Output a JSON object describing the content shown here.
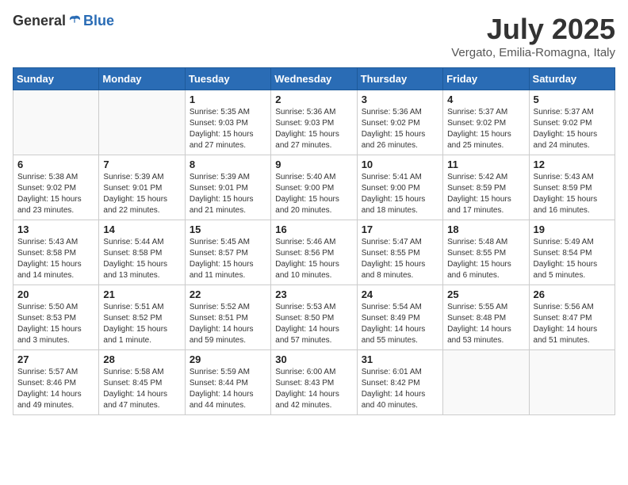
{
  "header": {
    "logo_general": "General",
    "logo_blue": "Blue",
    "month": "July 2025",
    "location": "Vergato, Emilia-Romagna, Italy"
  },
  "weekdays": [
    "Sunday",
    "Monday",
    "Tuesday",
    "Wednesday",
    "Thursday",
    "Friday",
    "Saturday"
  ],
  "weeks": [
    [
      {
        "day": "",
        "sunrise": "",
        "sunset": "",
        "daylight": ""
      },
      {
        "day": "",
        "sunrise": "",
        "sunset": "",
        "daylight": ""
      },
      {
        "day": "1",
        "sunrise": "Sunrise: 5:35 AM",
        "sunset": "Sunset: 9:03 PM",
        "daylight": "Daylight: 15 hours and 27 minutes."
      },
      {
        "day": "2",
        "sunrise": "Sunrise: 5:36 AM",
        "sunset": "Sunset: 9:03 PM",
        "daylight": "Daylight: 15 hours and 27 minutes."
      },
      {
        "day": "3",
        "sunrise": "Sunrise: 5:36 AM",
        "sunset": "Sunset: 9:02 PM",
        "daylight": "Daylight: 15 hours and 26 minutes."
      },
      {
        "day": "4",
        "sunrise": "Sunrise: 5:37 AM",
        "sunset": "Sunset: 9:02 PM",
        "daylight": "Daylight: 15 hours and 25 minutes."
      },
      {
        "day": "5",
        "sunrise": "Sunrise: 5:37 AM",
        "sunset": "Sunset: 9:02 PM",
        "daylight": "Daylight: 15 hours and 24 minutes."
      }
    ],
    [
      {
        "day": "6",
        "sunrise": "Sunrise: 5:38 AM",
        "sunset": "Sunset: 9:02 PM",
        "daylight": "Daylight: 15 hours and 23 minutes."
      },
      {
        "day": "7",
        "sunrise": "Sunrise: 5:39 AM",
        "sunset": "Sunset: 9:01 PM",
        "daylight": "Daylight: 15 hours and 22 minutes."
      },
      {
        "day": "8",
        "sunrise": "Sunrise: 5:39 AM",
        "sunset": "Sunset: 9:01 PM",
        "daylight": "Daylight: 15 hours and 21 minutes."
      },
      {
        "day": "9",
        "sunrise": "Sunrise: 5:40 AM",
        "sunset": "Sunset: 9:00 PM",
        "daylight": "Daylight: 15 hours and 20 minutes."
      },
      {
        "day": "10",
        "sunrise": "Sunrise: 5:41 AM",
        "sunset": "Sunset: 9:00 PM",
        "daylight": "Daylight: 15 hours and 18 minutes."
      },
      {
        "day": "11",
        "sunrise": "Sunrise: 5:42 AM",
        "sunset": "Sunset: 8:59 PM",
        "daylight": "Daylight: 15 hours and 17 minutes."
      },
      {
        "day": "12",
        "sunrise": "Sunrise: 5:43 AM",
        "sunset": "Sunset: 8:59 PM",
        "daylight": "Daylight: 15 hours and 16 minutes."
      }
    ],
    [
      {
        "day": "13",
        "sunrise": "Sunrise: 5:43 AM",
        "sunset": "Sunset: 8:58 PM",
        "daylight": "Daylight: 15 hours and 14 minutes."
      },
      {
        "day": "14",
        "sunrise": "Sunrise: 5:44 AM",
        "sunset": "Sunset: 8:58 PM",
        "daylight": "Daylight: 15 hours and 13 minutes."
      },
      {
        "day": "15",
        "sunrise": "Sunrise: 5:45 AM",
        "sunset": "Sunset: 8:57 PM",
        "daylight": "Daylight: 15 hours and 11 minutes."
      },
      {
        "day": "16",
        "sunrise": "Sunrise: 5:46 AM",
        "sunset": "Sunset: 8:56 PM",
        "daylight": "Daylight: 15 hours and 10 minutes."
      },
      {
        "day": "17",
        "sunrise": "Sunrise: 5:47 AM",
        "sunset": "Sunset: 8:55 PM",
        "daylight": "Daylight: 15 hours and 8 minutes."
      },
      {
        "day": "18",
        "sunrise": "Sunrise: 5:48 AM",
        "sunset": "Sunset: 8:55 PM",
        "daylight": "Daylight: 15 hours and 6 minutes."
      },
      {
        "day": "19",
        "sunrise": "Sunrise: 5:49 AM",
        "sunset": "Sunset: 8:54 PM",
        "daylight": "Daylight: 15 hours and 5 minutes."
      }
    ],
    [
      {
        "day": "20",
        "sunrise": "Sunrise: 5:50 AM",
        "sunset": "Sunset: 8:53 PM",
        "daylight": "Daylight: 15 hours and 3 minutes."
      },
      {
        "day": "21",
        "sunrise": "Sunrise: 5:51 AM",
        "sunset": "Sunset: 8:52 PM",
        "daylight": "Daylight: 15 hours and 1 minute."
      },
      {
        "day": "22",
        "sunrise": "Sunrise: 5:52 AM",
        "sunset": "Sunset: 8:51 PM",
        "daylight": "Daylight: 14 hours and 59 minutes."
      },
      {
        "day": "23",
        "sunrise": "Sunrise: 5:53 AM",
        "sunset": "Sunset: 8:50 PM",
        "daylight": "Daylight: 14 hours and 57 minutes."
      },
      {
        "day": "24",
        "sunrise": "Sunrise: 5:54 AM",
        "sunset": "Sunset: 8:49 PM",
        "daylight": "Daylight: 14 hours and 55 minutes."
      },
      {
        "day": "25",
        "sunrise": "Sunrise: 5:55 AM",
        "sunset": "Sunset: 8:48 PM",
        "daylight": "Daylight: 14 hours and 53 minutes."
      },
      {
        "day": "26",
        "sunrise": "Sunrise: 5:56 AM",
        "sunset": "Sunset: 8:47 PM",
        "daylight": "Daylight: 14 hours and 51 minutes."
      }
    ],
    [
      {
        "day": "27",
        "sunrise": "Sunrise: 5:57 AM",
        "sunset": "Sunset: 8:46 PM",
        "daylight": "Daylight: 14 hours and 49 minutes."
      },
      {
        "day": "28",
        "sunrise": "Sunrise: 5:58 AM",
        "sunset": "Sunset: 8:45 PM",
        "daylight": "Daylight: 14 hours and 47 minutes."
      },
      {
        "day": "29",
        "sunrise": "Sunrise: 5:59 AM",
        "sunset": "Sunset: 8:44 PM",
        "daylight": "Daylight: 14 hours and 44 minutes."
      },
      {
        "day": "30",
        "sunrise": "Sunrise: 6:00 AM",
        "sunset": "Sunset: 8:43 PM",
        "daylight": "Daylight: 14 hours and 42 minutes."
      },
      {
        "day": "31",
        "sunrise": "Sunrise: 6:01 AM",
        "sunset": "Sunset: 8:42 PM",
        "daylight": "Daylight: 14 hours and 40 minutes."
      },
      {
        "day": "",
        "sunrise": "",
        "sunset": "",
        "daylight": ""
      },
      {
        "day": "",
        "sunrise": "",
        "sunset": "",
        "daylight": ""
      }
    ]
  ]
}
